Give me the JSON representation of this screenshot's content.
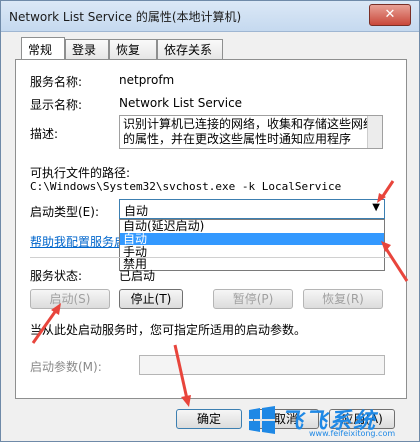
{
  "window": {
    "title": "Network List Service 的属性(本地计算机)",
    "close_glyph": "✕"
  },
  "tabs": [
    {
      "label": "常规",
      "active": true
    },
    {
      "label": "登录"
    },
    {
      "label": "恢复"
    },
    {
      "label": "依存关系"
    }
  ],
  "general": {
    "service_name_label": "服务名称:",
    "service_name_value": "netprofm",
    "display_name_label": "显示名称:",
    "display_name_value": "Network List Service",
    "description_label": "描述:",
    "description_value": "识别计算机已连接的网络，收集和存储这些网络的属性，并在更改这些属性时通知应用程序",
    "exe_path_label": "可执行文件的路径:",
    "exe_path_value": "C:\\Windows\\System32\\svchost.exe -k LocalService",
    "startup_type_label": "启动类型(E):",
    "startup_type_value": "自动",
    "startup_options": [
      "自动(延迟启动)",
      "自动",
      "手动",
      "禁用"
    ],
    "startup_selected_index": 1,
    "help_link": "帮助我配置服务启动",
    "status_label": "服务状态:",
    "status_value": "已启动",
    "btn_start": "启动(S)",
    "btn_stop": "停止(T)",
    "btn_pause": "暂停(P)",
    "btn_resume": "恢复(R)",
    "hint_text": "当从此处启动服务时，您可指定所适用的启动参数。",
    "param_label": "启动参数(M):",
    "param_value": ""
  },
  "footer": {
    "ok": "确定",
    "cancel": "取消",
    "apply": "应用(A)"
  },
  "watermark": {
    "brand": "飞飞系统",
    "url": "www.feifeixitong.com"
  },
  "colors": {
    "annotation_arrow": "#e8453c",
    "selection": "#3399ff",
    "link": "#0066cc"
  }
}
